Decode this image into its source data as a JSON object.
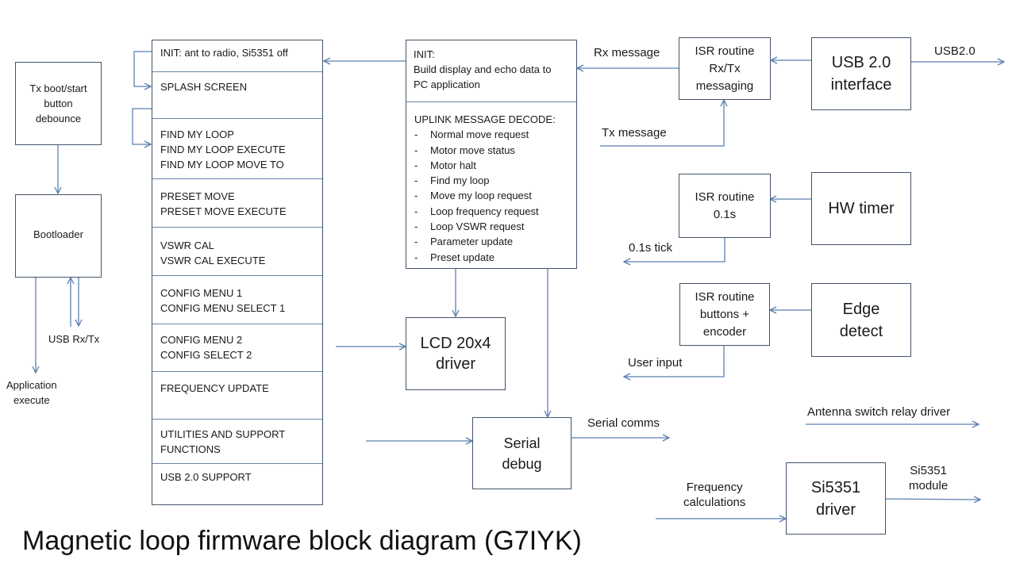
{
  "title": "Magnetic loop firmware block diagram (G7IYK)",
  "left_column": {
    "tx_boot_box": [
      "Tx boot/start",
      "button",
      "debounce"
    ],
    "bootloader_box": "Bootloader",
    "usb_rx_tx_label": "USB Rx/Tx",
    "application_execute_label": [
      "Application",
      "execute"
    ]
  },
  "state_machine": {
    "sections": [
      [
        "INIT:  ant to radio, Si5351 off"
      ],
      [
        "SPLASH SCREEN"
      ],
      [
        "FIND MY LOOP",
        "FIND MY LOOP EXECUTE",
        "FIND MY LOOP MOVE TO"
      ],
      [
        "PRESET MOVE",
        "PRESET MOVE EXECUTE"
      ],
      [
        "VSWR CAL",
        "VSWR CAL EXECUTE"
      ],
      [
        "CONFIG MENU 1",
        "CONFIG MENU SELECT 1"
      ],
      [
        "CONFIG MENU 2",
        "CONFIG SELECT 2"
      ],
      [
        "FREQUENCY UPDATE"
      ],
      [
        "UTILITIES AND SUPPORT",
        "FUNCTIONS"
      ],
      [
        "USB 2.0 SUPPORT"
      ]
    ]
  },
  "uplink_box": {
    "init_title": "INIT:",
    "init_lines": [
      "Build display and echo data to",
      "PC application"
    ],
    "decode_title": "UPLINK MESSAGE DECODE:",
    "decode_items": [
      "Normal move request",
      "Motor move status",
      "Motor halt",
      "Find my loop",
      "Move my loop request",
      "Loop frequency request",
      "Loop VSWR request",
      "Parameter update",
      "Preset update"
    ]
  },
  "lcd_box": [
    "LCD 20x4",
    "driver"
  ],
  "serial_debug_box": [
    "Serial",
    "debug"
  ],
  "serial_comms_label": "Serial comms",
  "usb_section": {
    "rx_message_label": "Rx message",
    "tx_message_label": "Tx message",
    "isr_rxtx_box": [
      "ISR routine",
      "Rx/Tx",
      "messaging"
    ],
    "usb_interface_box": [
      "USB 2.0",
      "interface"
    ],
    "usb20_label": "USB2.0"
  },
  "timer_section": {
    "isr_timer_box": [
      "ISR routine",
      "0.1s"
    ],
    "hw_timer_box": "HW timer",
    "tick_label": "0.1s tick"
  },
  "edge_section": {
    "isr_buttons_box": [
      "ISR routine",
      "buttons +",
      "encoder"
    ],
    "edge_detect_box": [
      "Edge",
      "detect"
    ],
    "user_input_label": "User input"
  },
  "antenna_label": "Antenna switch relay driver",
  "si5351_section": {
    "frequency_label": [
      "Frequency",
      "calculations"
    ],
    "driver_box": [
      "Si5351",
      "driver"
    ],
    "module_label": [
      "Si5351",
      "module"
    ]
  }
}
